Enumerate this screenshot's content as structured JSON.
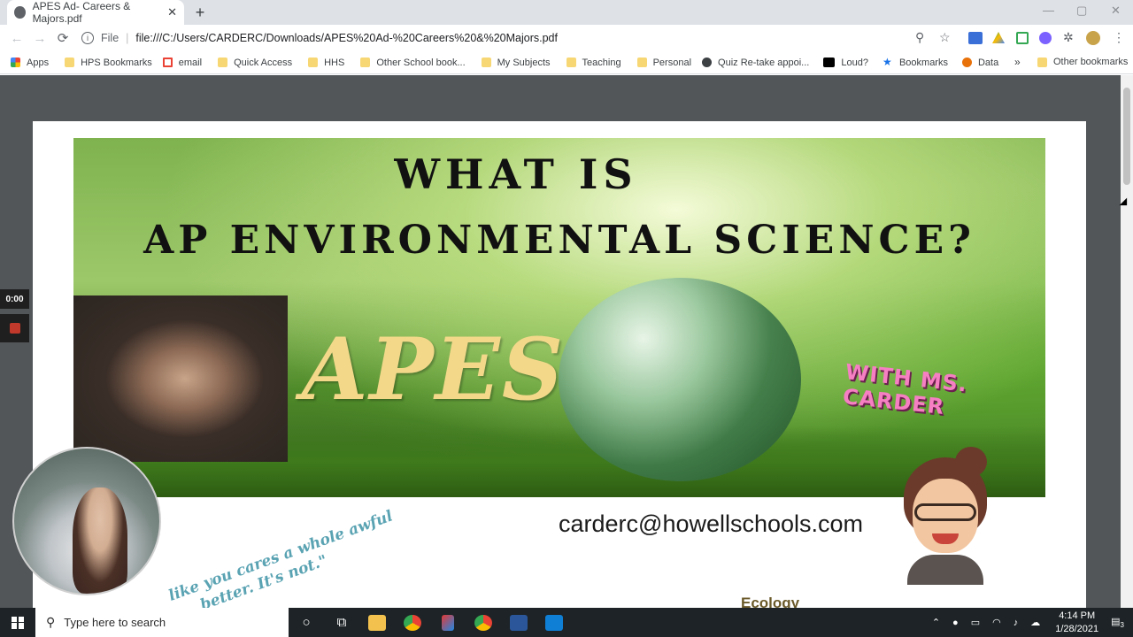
{
  "browser": {
    "tab_title": "APES Ad- Careers & Majors.pdf",
    "tab_close": "✕",
    "new_tab": "+",
    "window_controls": {
      "minimize": "—",
      "maximize": "▢",
      "close": "✕"
    },
    "nav": {
      "back": "←",
      "forward": "→",
      "reload": "⟳"
    },
    "address": {
      "info": "i",
      "scheme": "File",
      "separator": "|",
      "url": "file:///C:/Users/CARDERC/Downloads/APES%20Ad-%20Careers%20&%20Majors.pdf"
    },
    "toolbar_icons": {
      "zoom": "⚲",
      "star": "☆",
      "extensions": "✲",
      "menu": "⋮"
    }
  },
  "bookmarks": {
    "items": [
      {
        "label": "Apps",
        "icon": "apps-grid-icon"
      },
      {
        "label": "HPS Bookmarks",
        "icon": "folder-icon"
      },
      {
        "label": "email",
        "icon": "gmail-icon"
      },
      {
        "label": "Quick Access",
        "icon": "folder-icon"
      },
      {
        "label": "HHS",
        "icon": "folder-icon"
      },
      {
        "label": "Other School book...",
        "icon": "folder-icon"
      },
      {
        "label": "My Subjects",
        "icon": "folder-icon"
      },
      {
        "label": "Teaching",
        "icon": "folder-icon"
      },
      {
        "label": "Personal",
        "icon": "folder-icon"
      },
      {
        "label": "Quiz Re-take appoi...",
        "icon": "globe-icon"
      },
      {
        "label": "Loud?",
        "icon": "na-icon"
      },
      {
        "label": "Bookmarks",
        "icon": "star-icon"
      },
      {
        "label": "Data",
        "icon": "gear-icon"
      }
    ],
    "overflow": "»",
    "other": "Other bookmarks"
  },
  "pdf": {
    "title_line1": "WHAT IS",
    "title_line2": "AP ENVIRONMENTAL SCIENCE?",
    "apes": "APES",
    "with": "WITH MS. CARDER",
    "email": "carderc@howellschools.com",
    "quote_line1": "like you cares a whole awful",
    "quote_line2": "better. It's not.\"",
    "ecology": "Ecology"
  },
  "recording": {
    "timer": "0:00"
  },
  "taskbar": {
    "search_placeholder": "Type here to search",
    "time": "4:14 PM",
    "date": "1/28/2021",
    "notifications": "3"
  },
  "colors": {
    "viewer_bg": "#525659",
    "taskbar_bg": "#1d2326",
    "apes_text": "#f3d88a",
    "carder_tag": "#f57fc2"
  }
}
